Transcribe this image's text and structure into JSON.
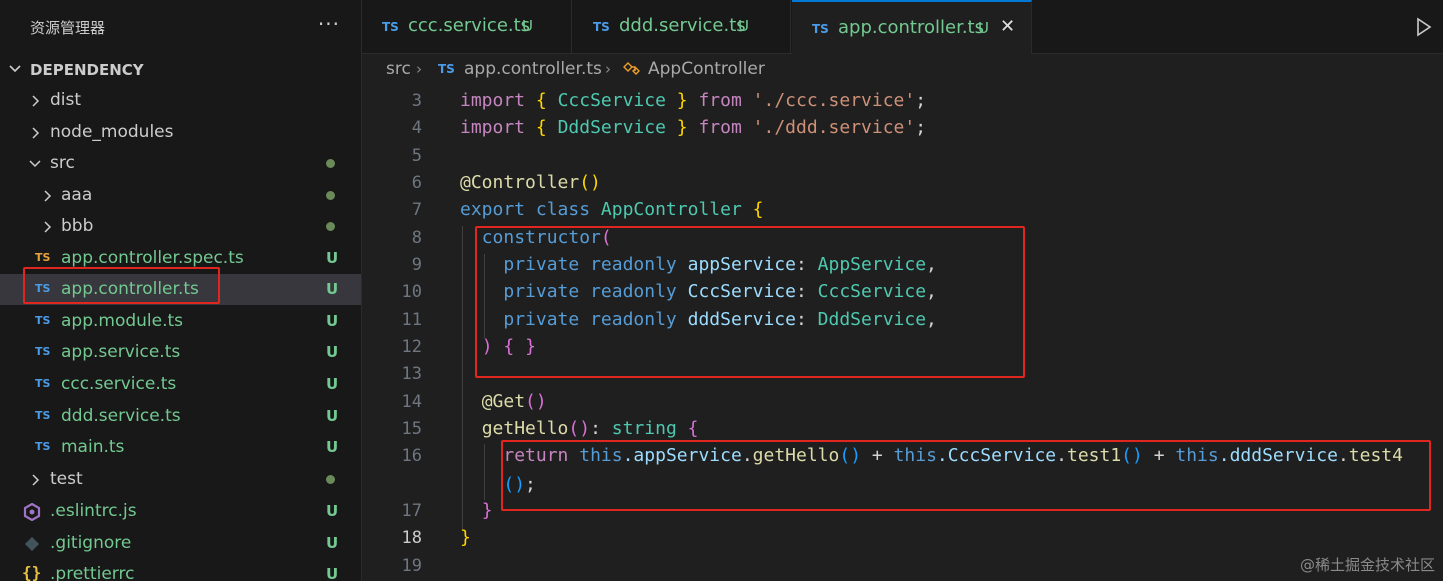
{
  "sidebar": {
    "title": "资源管理器",
    "more": "···",
    "section": "DEPENDENCY",
    "items": [
      {
        "name": "dist",
        "kind": "folder",
        "status": "",
        "chev": "right"
      },
      {
        "name": "node_modules",
        "kind": "folder",
        "status": "",
        "chev": "right"
      },
      {
        "name": "src",
        "kind": "folder",
        "status": "dot",
        "chev": "down"
      },
      {
        "name": "aaa",
        "kind": "folder",
        "status": "dot",
        "chev": "right"
      },
      {
        "name": "bbb",
        "kind": "folder",
        "status": "dot",
        "chev": "right"
      },
      {
        "name": "app.controller.spec.ts",
        "kind": "ts-test",
        "status": "U"
      },
      {
        "name": "app.controller.ts",
        "kind": "ts",
        "status": "U"
      },
      {
        "name": "app.module.ts",
        "kind": "ts",
        "status": "U"
      },
      {
        "name": "app.service.ts",
        "kind": "ts",
        "status": "U"
      },
      {
        "name": "ccc.service.ts",
        "kind": "ts",
        "status": "U"
      },
      {
        "name": "ddd.service.ts",
        "kind": "ts",
        "status": "U"
      },
      {
        "name": "main.ts",
        "kind": "ts",
        "status": "U"
      },
      {
        "name": "test",
        "kind": "folder",
        "status": "dot",
        "chev": "right"
      },
      {
        "name": ".eslintrc.js",
        "kind": "eslint",
        "status": "U"
      },
      {
        "name": ".gitignore",
        "kind": "git",
        "status": "U"
      },
      {
        "name": ".prettierrc",
        "kind": "json",
        "status": "U"
      }
    ],
    "file_icon_text": "TS"
  },
  "tabs": [
    {
      "label": "ccc.service.ts",
      "badge": "U",
      "active": false
    },
    {
      "label": "ddd.service.ts",
      "badge": "U",
      "active": false
    },
    {
      "label": "app.controller.ts",
      "badge": "U",
      "active": true,
      "close": "✕"
    }
  ],
  "breadcrumb": {
    "folder": "src",
    "file": "app.controller.ts",
    "symbol": "AppController"
  },
  "editor": {
    "current_line": "18",
    "line_numbers": [
      "3",
      "4",
      "5",
      "6",
      "7",
      "8",
      "9",
      "10",
      "11",
      "12",
      "13",
      "14",
      "15",
      "16",
      "",
      "17",
      "18",
      "19"
    ],
    "code": {
      "l3": {
        "kw": "import",
        "ob": "{",
        "cls": "CccService",
        "cb": "}",
        "from": "from",
        "str": "'./ccc.service'",
        "semi": ";"
      },
      "l4": {
        "kw": "import",
        "ob": "{",
        "cls": "DddService",
        "cb": "}",
        "from": "from",
        "str": "'./ddd.service'",
        "semi": ";"
      },
      "l6": {
        "deco": "@Controller",
        "p": "()"
      },
      "l7": {
        "export": "export",
        "class": "class",
        "name": "AppController",
        "ob": "{"
      },
      "l8": {
        "ctor": "constructor",
        "op": "("
      },
      "l9": {
        "private": "private",
        "readonly": "readonly",
        "name": "appService",
        "colon": ":",
        "type": "AppService",
        "comma": ","
      },
      "l10": {
        "private": "private",
        "readonly": "readonly",
        "name": "CccService",
        "colon": ":",
        "type": "CccService",
        "comma": ","
      },
      "l11": {
        "private": "private",
        "readonly": "readonly",
        "name": "dddService",
        "colon": ":",
        "type": "DddService",
        "comma": ","
      },
      "l12": {
        "cp": ")",
        "ob": "{",
        "cb": "}"
      },
      "l14": {
        "deco": "@Get",
        "p": "()"
      },
      "l15": {
        "fn": "getHello",
        "p": "()",
        "colon": ":",
        "type": "string",
        "ob": "{"
      },
      "l16": {
        "ret": "return",
        "this1": "this",
        "m1": ".appService",
        "dot1": ".",
        "f1": "getHello",
        "p1": "()",
        "plus1": " + ",
        "this2": "this",
        "m2": ".CccService",
        "dot2": ".",
        "f2": "test1",
        "p2": "()",
        "plus2": " + ",
        "this3": "this",
        "m3": ".dddService",
        "dot3": ".",
        "f3": "test4"
      },
      "l16b": {
        "p": "()",
        "semi": ";"
      },
      "l17": {
        "cb": "}"
      },
      "l18": {
        "cb": "}"
      }
    }
  },
  "watermark": "@稀土掘金技术社区",
  "colors": {
    "accent": "#0078d4",
    "highlight_box": "#e0261e",
    "untracked": "#73c991"
  }
}
